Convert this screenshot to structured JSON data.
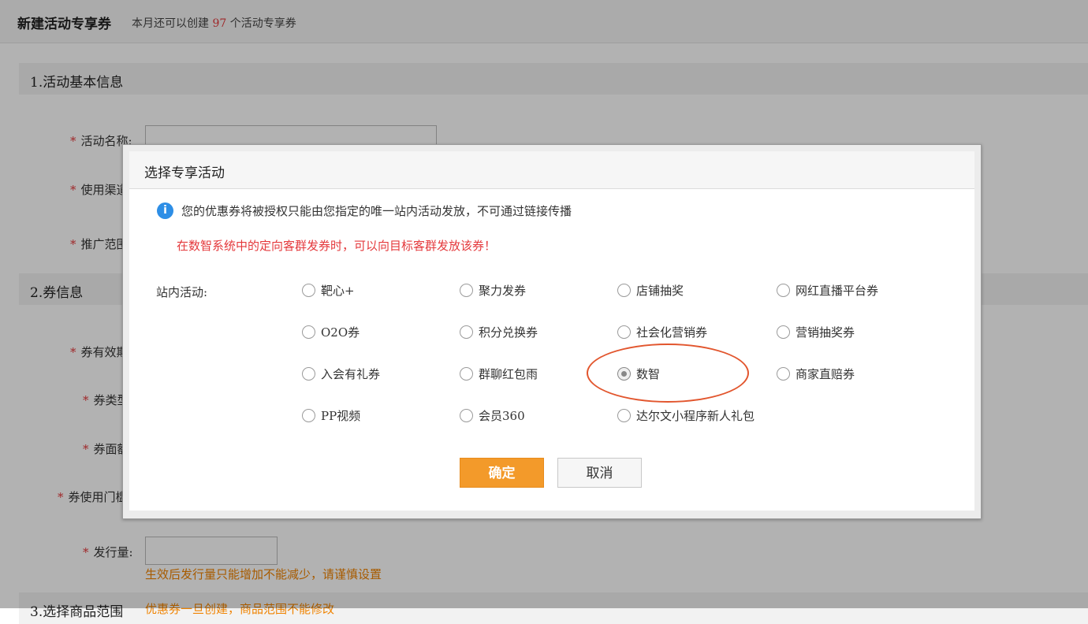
{
  "header": {
    "title": "新建活动专享券",
    "subtitle_prefix": "本月还可以创建",
    "subtitle_count": "97",
    "subtitle_suffix": "个活动专享券"
  },
  "sections": {
    "basic_info": "1.活动基本信息",
    "coupon_info": "2.券信息",
    "product_range": "3.选择商品范围",
    "product_range_note": "优惠券一旦创建，商品范围不能修改"
  },
  "form": {
    "required_mark": "*",
    "activity_name": "活动名称:",
    "channel": "使用渠道",
    "promo_range": "推广范围",
    "validity": "券有效期",
    "coupon_type": "券类型",
    "face_value": "券面额",
    "threshold": "券使用门槛",
    "issue_qty": "发行量:",
    "issue_qty_hint": "生效后发行量只能增加不能减少，请谨慎设置"
  },
  "modal": {
    "title": "选择专享活动",
    "info_icon": "i",
    "info_text": "您的优惠券将被授权只能由您指定的唯一站内活动发放，不可通过链接传播",
    "warning_text": "在数智系统中的定向客群发券时，可以向目标客群发放该券！",
    "field_label": "站内活动:",
    "options": [
      {
        "label": "靶心+",
        "checked": false
      },
      {
        "label": "聚力发券",
        "checked": false
      },
      {
        "label": "店铺抽奖",
        "checked": false
      },
      {
        "label": "网红直播平台券",
        "checked": false
      },
      {
        "label": "O2O券",
        "checked": false
      },
      {
        "label": "积分兑换券",
        "checked": false
      },
      {
        "label": "社会化营销券",
        "checked": false
      },
      {
        "label": "营销抽奖券",
        "checked": false
      },
      {
        "label": "入会有礼券",
        "checked": false
      },
      {
        "label": "群聊红包雨",
        "checked": false
      },
      {
        "label": "数智",
        "checked": true
      },
      {
        "label": "商家直赔券",
        "checked": false
      },
      {
        "label": "PP视频",
        "checked": false
      },
      {
        "label": "会员360",
        "checked": false
      },
      {
        "label": "达尔文小程序新人礼包",
        "checked": false
      }
    ],
    "ok_label": "确定",
    "cancel_label": "取消"
  },
  "colors": {
    "accent_orange": "#f39a2a",
    "warning_red": "#e4393c",
    "hint_orange": "#f08300",
    "info_blue": "#2d8ee6",
    "highlight": "#e2562e"
  }
}
